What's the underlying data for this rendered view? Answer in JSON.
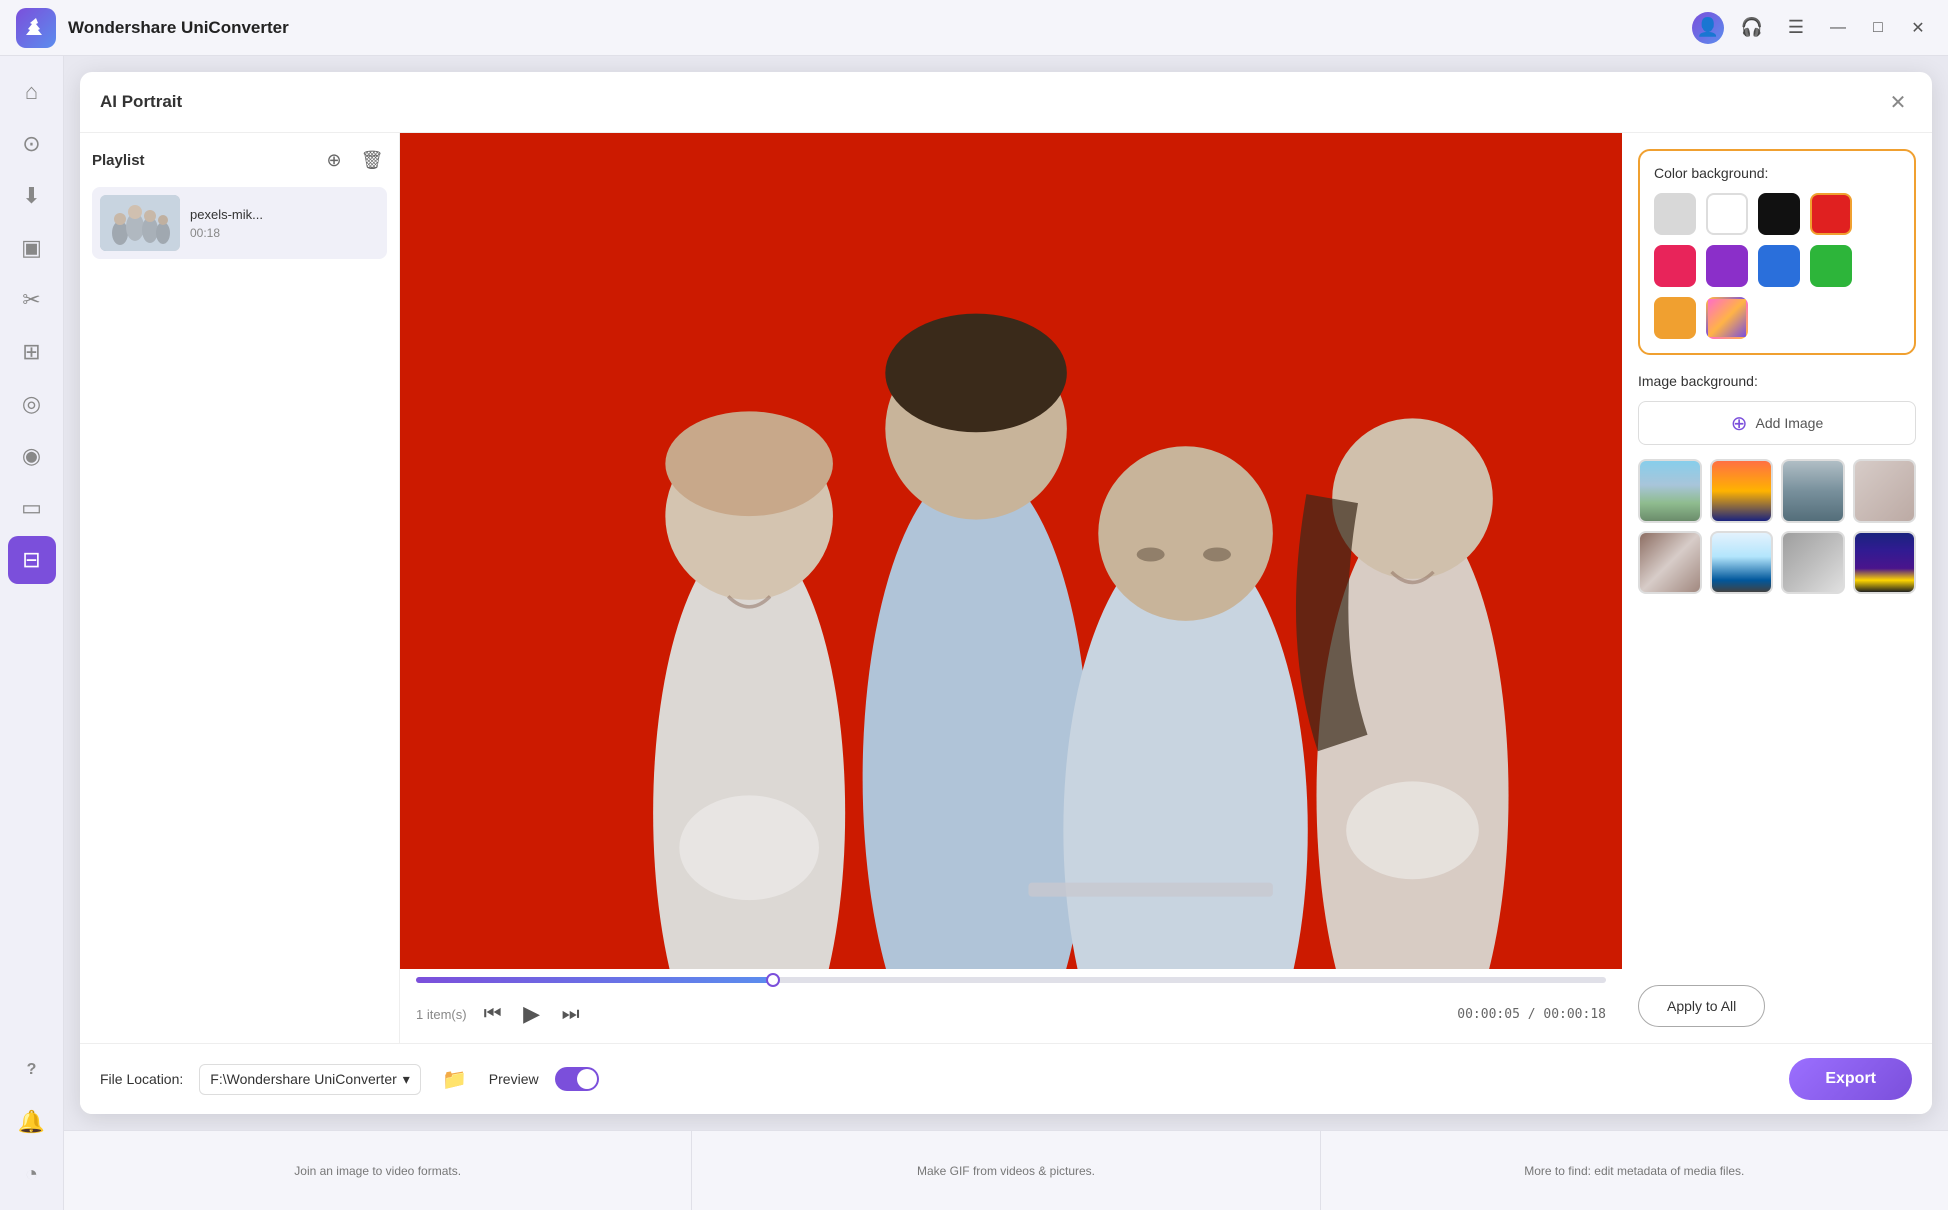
{
  "app": {
    "title": "Wondershare UniConverter",
    "logo_alt": "UniConverter Logo"
  },
  "titlebar": {
    "controls": {
      "minimize": "—",
      "maximize": "□",
      "close": "✕"
    }
  },
  "sidebar": {
    "items": [
      {
        "id": "home",
        "icon": "⌂",
        "label": "Home"
      },
      {
        "id": "media",
        "icon": "⊙",
        "label": "Media"
      },
      {
        "id": "download",
        "icon": "⬇",
        "label": "Download"
      },
      {
        "id": "edit",
        "icon": "▣",
        "label": "Edit"
      },
      {
        "id": "cut",
        "icon": "✂",
        "label": "Cut"
      },
      {
        "id": "merge",
        "icon": "⊞",
        "label": "Merge"
      },
      {
        "id": "screen",
        "icon": "◎",
        "label": "Screen Recorder"
      },
      {
        "id": "settings2",
        "icon": "◉",
        "label": "Settings"
      },
      {
        "id": "tv",
        "icon": "▭",
        "label": "TV"
      },
      {
        "id": "toolbox",
        "icon": "⊟",
        "label": "Toolbox"
      }
    ],
    "bottom": [
      {
        "id": "help",
        "icon": "?",
        "label": "Help"
      },
      {
        "id": "bell",
        "icon": "🔔",
        "label": "Notifications"
      },
      {
        "id": "activity",
        "icon": "◔",
        "label": "Activity"
      }
    ],
    "active_item": "toolbox"
  },
  "dialog": {
    "title": "AI Portrait",
    "close_label": "✕"
  },
  "playlist": {
    "title": "Playlist",
    "add_icon": "⊕",
    "delete_icon": "🗑",
    "items": [
      {
        "name": "pexels-mik...",
        "duration": "00:18"
      }
    ],
    "count": "1 item(s)"
  },
  "video": {
    "current_time": "00:00:05",
    "total_time": "00:00:18",
    "time_display": "00:00:05 / 00:00:18",
    "progress_pct": 30
  },
  "controls": {
    "prev": "⏮",
    "play": "▶",
    "next": "⏭"
  },
  "right_panel": {
    "color_bg_label": "Color background:",
    "colors": [
      {
        "id": "light-gray",
        "hex": "#d8d8d8"
      },
      {
        "id": "white",
        "hex": "#ffffff"
      },
      {
        "id": "black",
        "hex": "#111111"
      },
      {
        "id": "red",
        "hex": "#e02020"
      },
      {
        "id": "pink",
        "hex": "#e8245a"
      },
      {
        "id": "purple",
        "hex": "#8b2fc9"
      },
      {
        "id": "blue",
        "hex": "#2a6fdb"
      },
      {
        "id": "green",
        "hex": "#2db53a"
      },
      {
        "id": "orange",
        "hex": "#f0a030"
      },
      {
        "id": "gradient",
        "hex": "gradient"
      }
    ],
    "selected_color": "red",
    "image_bg_label": "Image background:",
    "add_image_label": "Add Image",
    "image_thumbs": [
      {
        "id": "mountain",
        "class": "img-mountain"
      },
      {
        "id": "sunset",
        "class": "img-sunset"
      },
      {
        "id": "building",
        "class": "img-building"
      },
      {
        "id": "beige",
        "class": "img-beige"
      },
      {
        "id": "interior",
        "class": "img-interior"
      },
      {
        "id": "window",
        "class": "img-window"
      },
      {
        "id": "office",
        "class": "img-office"
      },
      {
        "id": "night",
        "class": "img-night"
      }
    ],
    "apply_btn_label": "Apply to All"
  },
  "footer": {
    "file_location_label": "File Location:",
    "file_path": "F:\\Wondershare UniConverter",
    "preview_label": "Preview",
    "export_label": "Export"
  },
  "bottom_strip": {
    "items": [
      "Join an image to video formats.",
      "Make GIF from videos & pictures.",
      "More to find: edit metadata of media files."
    ]
  }
}
